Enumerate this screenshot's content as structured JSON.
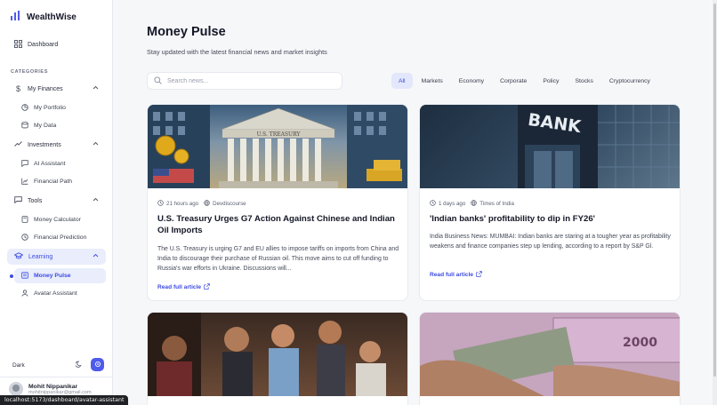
{
  "brand": {
    "title": "WealthWise"
  },
  "sidebar": {
    "dashboard": "Dashboard",
    "categories_label": "CATEGORIES",
    "groups": [
      {
        "label": "My Finances",
        "items": [
          "My Portfolio",
          "My Data"
        ]
      },
      {
        "label": "Investments",
        "items": [
          "AI Assistant",
          "Financial Path"
        ]
      },
      {
        "label": "Tools",
        "items": [
          "Money Calculator",
          "Financial Prediction"
        ]
      },
      {
        "label": "Learning",
        "items": [
          "Money Pulse",
          "Avatar Assistant"
        ]
      }
    ],
    "theme_label": "Dark",
    "user_name": "Mohit Nippanikar",
    "user_email": "mohitnippanikar@gmail.com"
  },
  "status_url": "localhost:5173/dashboard/avatar-assistant",
  "main": {
    "title": "Money Pulse",
    "subtitle": "Stay updated with the latest financial news and market insights",
    "search_placeholder": "Search news...",
    "filters": [
      "All",
      "Markets",
      "Economy",
      "Corporate",
      "Policy",
      "Stocks",
      "Cryptocurrency"
    ],
    "active_filter": "All"
  },
  "articles": [
    {
      "time": "21 hours ago",
      "source": "Devdiscourse",
      "title": "U.S. Treasury Urges G7 Action Against Chinese and Indian Oil Imports",
      "excerpt": "The U.S. Treasury is urging G7 and EU allies to impose tariffs on imports from China and India to discourage their purchase of Russian oil. This move aims to cut off funding to Russia's war efforts in Ukraine. Discussions will...",
      "read_more": "Read full article",
      "image_text": "U.S. TREASURY"
    },
    {
      "time": "1 days ago",
      "source": "Times of India",
      "title": "'Indian banks' profitability to dip in FY26'",
      "excerpt": "India Business News: MUMBAI: Indian banks are staring at a tougher year as profitability weakens and finance companies step up lending, according to a report by S&P Gl.",
      "read_more": "Read full article",
      "image_text": "BANK"
    },
    {
      "image_text": ""
    },
    {
      "image_text": "2000"
    }
  ],
  "colors": {
    "accent": "#3c4be0",
    "accent_bg": "#e9edfc"
  }
}
